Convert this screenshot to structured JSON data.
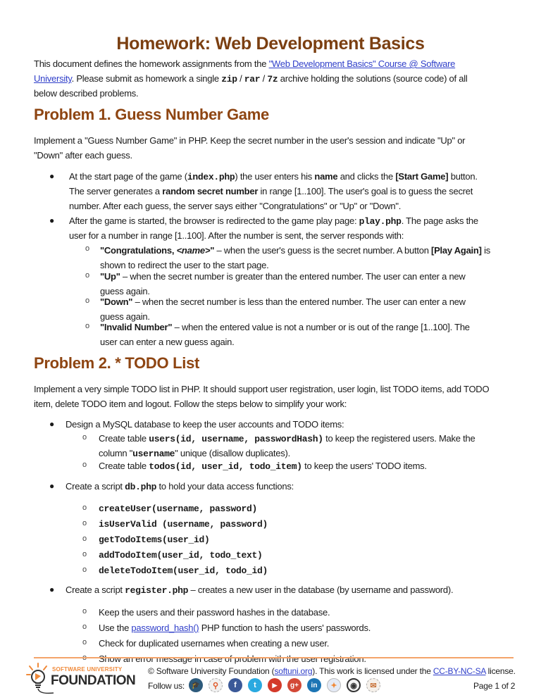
{
  "document": {
    "title": "Homework: Web Development Basics",
    "intro": {
      "line1_prefix": "This document defines the homework assignments from the ",
      "course_link": "\"Web Development Basics\" Course @ Software",
      "course_link_cont": "University",
      "line2_mid": ". Please submit as homework a single ",
      "zip": "zip",
      "sep1": " / ",
      "rar": "rar",
      "sep2": " / ",
      "sevenz": "7z",
      "line2_suffix": " archive holding the solutions (source code) of all",
      "line3": "below described problems."
    },
    "problem1": {
      "heading": "Problem 1.   Guess Number Game",
      "desc_line1": "Implement a \"Guess Number Game\" in PHP. Keep the secret number in the user's session and indicate \"Up\" or",
      "desc_line2": "\"Down\" after each guess.",
      "bullets": [
        {
          "l1a": "At the start page of the game (",
          "l1code": "index.php",
          "l1b": ") the user enters his ",
          "l1bold": "name",
          "l1c": " and clicks the ",
          "l1bold2": "[Start Game]",
          "l1d": " button.",
          "l2a": "The server generates a ",
          "l2bold": "random secret number",
          "l2b": " in range [1..100]. The user's goal is to guess the secret",
          "l3": "number. After each guess, the server says either \"Congratulations\" or \"Up\" or \"Down\"."
        },
        {
          "l1a": "After the game is started, the browser is redirected to the game play page: ",
          "l1code": "play.php",
          "l1b": ". The page asks the",
          "l2": "user for a number in range [1..100]. After the number is sent, the server responds with:"
        }
      ],
      "responses": [
        {
          "bold_a": "\"Congratulations, ",
          "italic": "<name>",
          "bold_b": "\"",
          "rest1": " – when the user's guess is the secret number. A button ",
          "bold2": "[Play Again]",
          "rest2": " is",
          "line2": "shown to redirect the user to the start page."
        },
        {
          "bold": "\"Up\"",
          "rest": " – when the secret number is greater than the entered number. The user can enter a new",
          "line2": "guess again."
        },
        {
          "bold": "\"Down\"",
          "rest": " – when the secret number is less than the entered number. The user can enter a new",
          "line2": "guess again."
        },
        {
          "bold": "\"Invalid Number\"",
          "rest": " – when the entered value is not a number or is out of the range [1..100]. The",
          "line2": "user can enter a new guess again."
        }
      ]
    },
    "problem2": {
      "heading": "Problem 2.   * TODO List",
      "desc_line1": "Implement a very simple TODO list in PHP. It should support user registration, user login, list TODO items, add TODO",
      "desc_line2": "item, delete TODO item and logout. Follow the steps below to simplify your work:",
      "bullet_db_design": "Design a MySQL database to keep the user accounts and TODO items:",
      "table_users": {
        "prefix": "Create table ",
        "code": "users(id, username, passwordHash)",
        "suffix": " to keep the registered users. Make the",
        "line2_prefix": "column \"",
        "line2_code": "username",
        "line2_suffix": "\" unique (disallow duplicates)."
      },
      "table_todos": {
        "prefix": "Create table ",
        "code": "todos(id, user_id, todo_item)",
        "suffix": " to keep the users' TODO items."
      },
      "bullet_db_script": {
        "prefix": "Create a script ",
        "code": "db.php",
        "suffix": " to hold your data access functions:"
      },
      "functions": [
        "createUser(username, password)",
        "isUserValid (username, password)",
        "getTodoItems(user_id)",
        "addTodoItem(user_id, todo_text)",
        "deleteTodoItem(user_id, todo_id)"
      ],
      "bullet_register": {
        "prefix": "Create a script ",
        "code": "register.php",
        "suffix": " – creates a new user in the database (by username and password)."
      },
      "register_items": [
        {
          "text": "Keep the users and their password hashes in the database."
        },
        {
          "prefix": "Use the ",
          "link": "password_hash()",
          "suffix": " PHP function to hash the users' passwords."
        },
        {
          "text": "Check for duplicated usernames when creating a new user."
        },
        {
          "text": "Show an error message in case of problem with the user registration."
        }
      ]
    }
  },
  "footer": {
    "logo_top": "SOFTWARE UNIVERSITY",
    "logo_main": "FOUNDATION",
    "copyright_prefix": "© Software University Foundation (",
    "site_link": "softuni.org",
    "copyright_mid": "). This work is licensed under the ",
    "license_link": "CC-BY-NC-SA",
    "copyright_suffix": " license.",
    "follow_label": "Follow us:",
    "social_icons": [
      {
        "name": "softuni-icon",
        "glyph": "🎓",
        "color": "#2d5a7b"
      },
      {
        "name": "search-people-icon",
        "glyph": "⚲",
        "color": "#e8e8e8"
      },
      {
        "name": "facebook-icon",
        "glyph": "f",
        "color": "#3b5998"
      },
      {
        "name": "twitter-icon",
        "glyph": "t",
        "color": "#2aa9e0"
      },
      {
        "name": "youtube-icon",
        "glyph": "▶",
        "color": "#d43a2a"
      },
      {
        "name": "google-plus-icon",
        "glyph": "g+",
        "color": "#d34836"
      },
      {
        "name": "linkedin-icon",
        "glyph": "in",
        "color": "#1c75b4"
      },
      {
        "name": "community-icon",
        "glyph": "✦",
        "color": "#e4eaf6"
      },
      {
        "name": "forum-icon",
        "glyph": "◉",
        "color": "#f2f2f2"
      },
      {
        "name": "mail-icon",
        "glyph": "✉",
        "color": "#efe6de"
      }
    ],
    "page_label": "Page 1 of 2"
  },
  "colors": {
    "title": "#7b3f11",
    "heading": "#8e4512",
    "link": "#2f3ec9",
    "footer_rule": "#f4a46a"
  }
}
